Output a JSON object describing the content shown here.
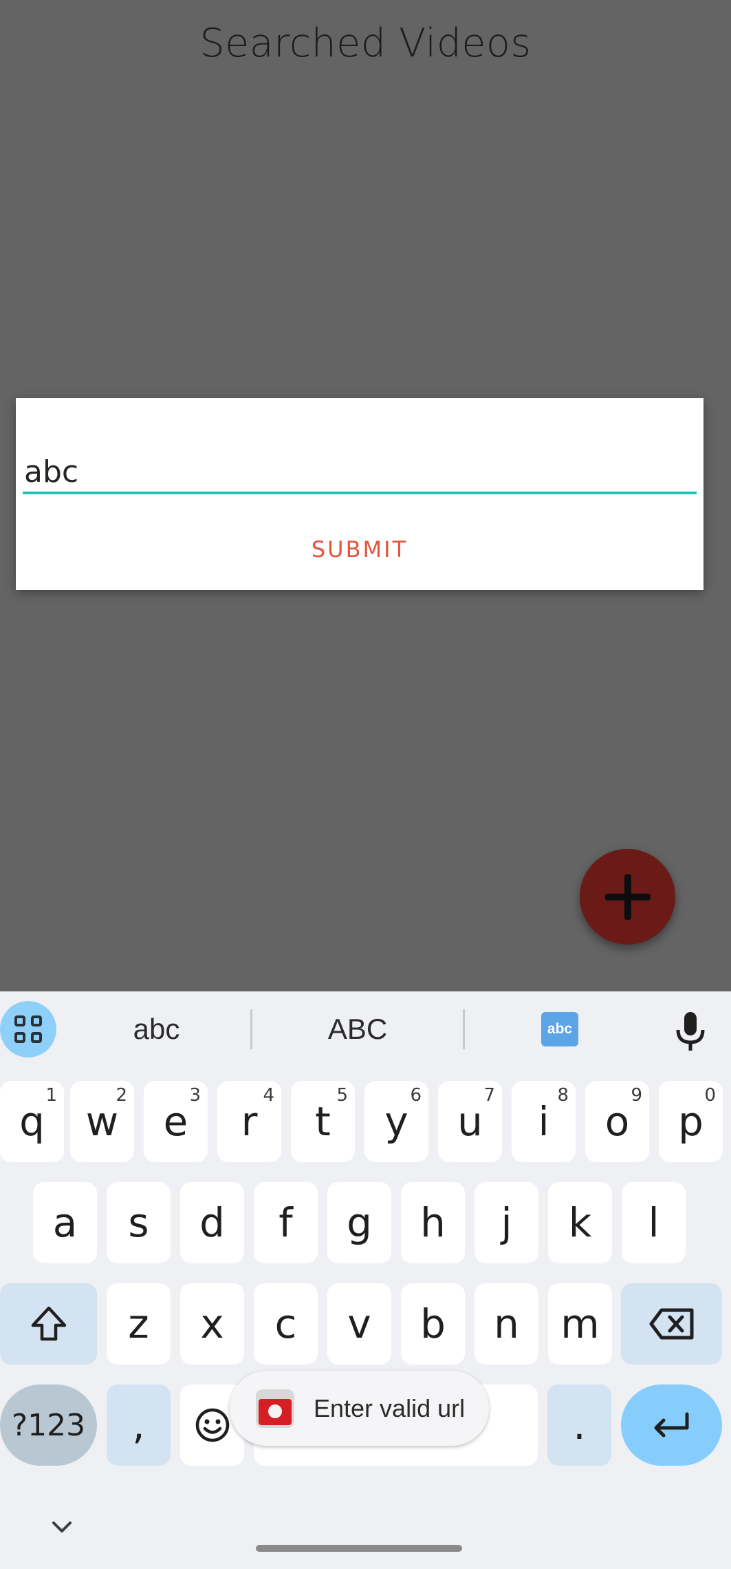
{
  "page": {
    "title": "Searched Videos"
  },
  "dialog": {
    "input_value": "abc",
    "submit_label": "SUBMIT"
  },
  "fab": {
    "icon": "plus-icon"
  },
  "keyboard": {
    "suggestions": [
      "abc",
      "ABC"
    ],
    "emoji_suggestion_label": "abc",
    "row1": [
      {
        "k": "q",
        "h": "1"
      },
      {
        "k": "w",
        "h": "2"
      },
      {
        "k": "e",
        "h": "3"
      },
      {
        "k": "r",
        "h": "4"
      },
      {
        "k": "t",
        "h": "5"
      },
      {
        "k": "y",
        "h": "6"
      },
      {
        "k": "u",
        "h": "7"
      },
      {
        "k": "i",
        "h": "8"
      },
      {
        "k": "o",
        "h": "9"
      },
      {
        "k": "p",
        "h": "0"
      }
    ],
    "row2": [
      "a",
      "s",
      "d",
      "f",
      "g",
      "h",
      "j",
      "k",
      "l"
    ],
    "row3": [
      "z",
      "x",
      "c",
      "v",
      "b",
      "n",
      "m"
    ],
    "symbols_label": "?123",
    "comma_label": ",",
    "period_label": "."
  },
  "toast": {
    "text": "Enter valid url"
  },
  "colors": {
    "accent": "#1fc3b6",
    "submit": "#e4533d",
    "fab": "#6a1b17",
    "scrim": "#646464"
  }
}
